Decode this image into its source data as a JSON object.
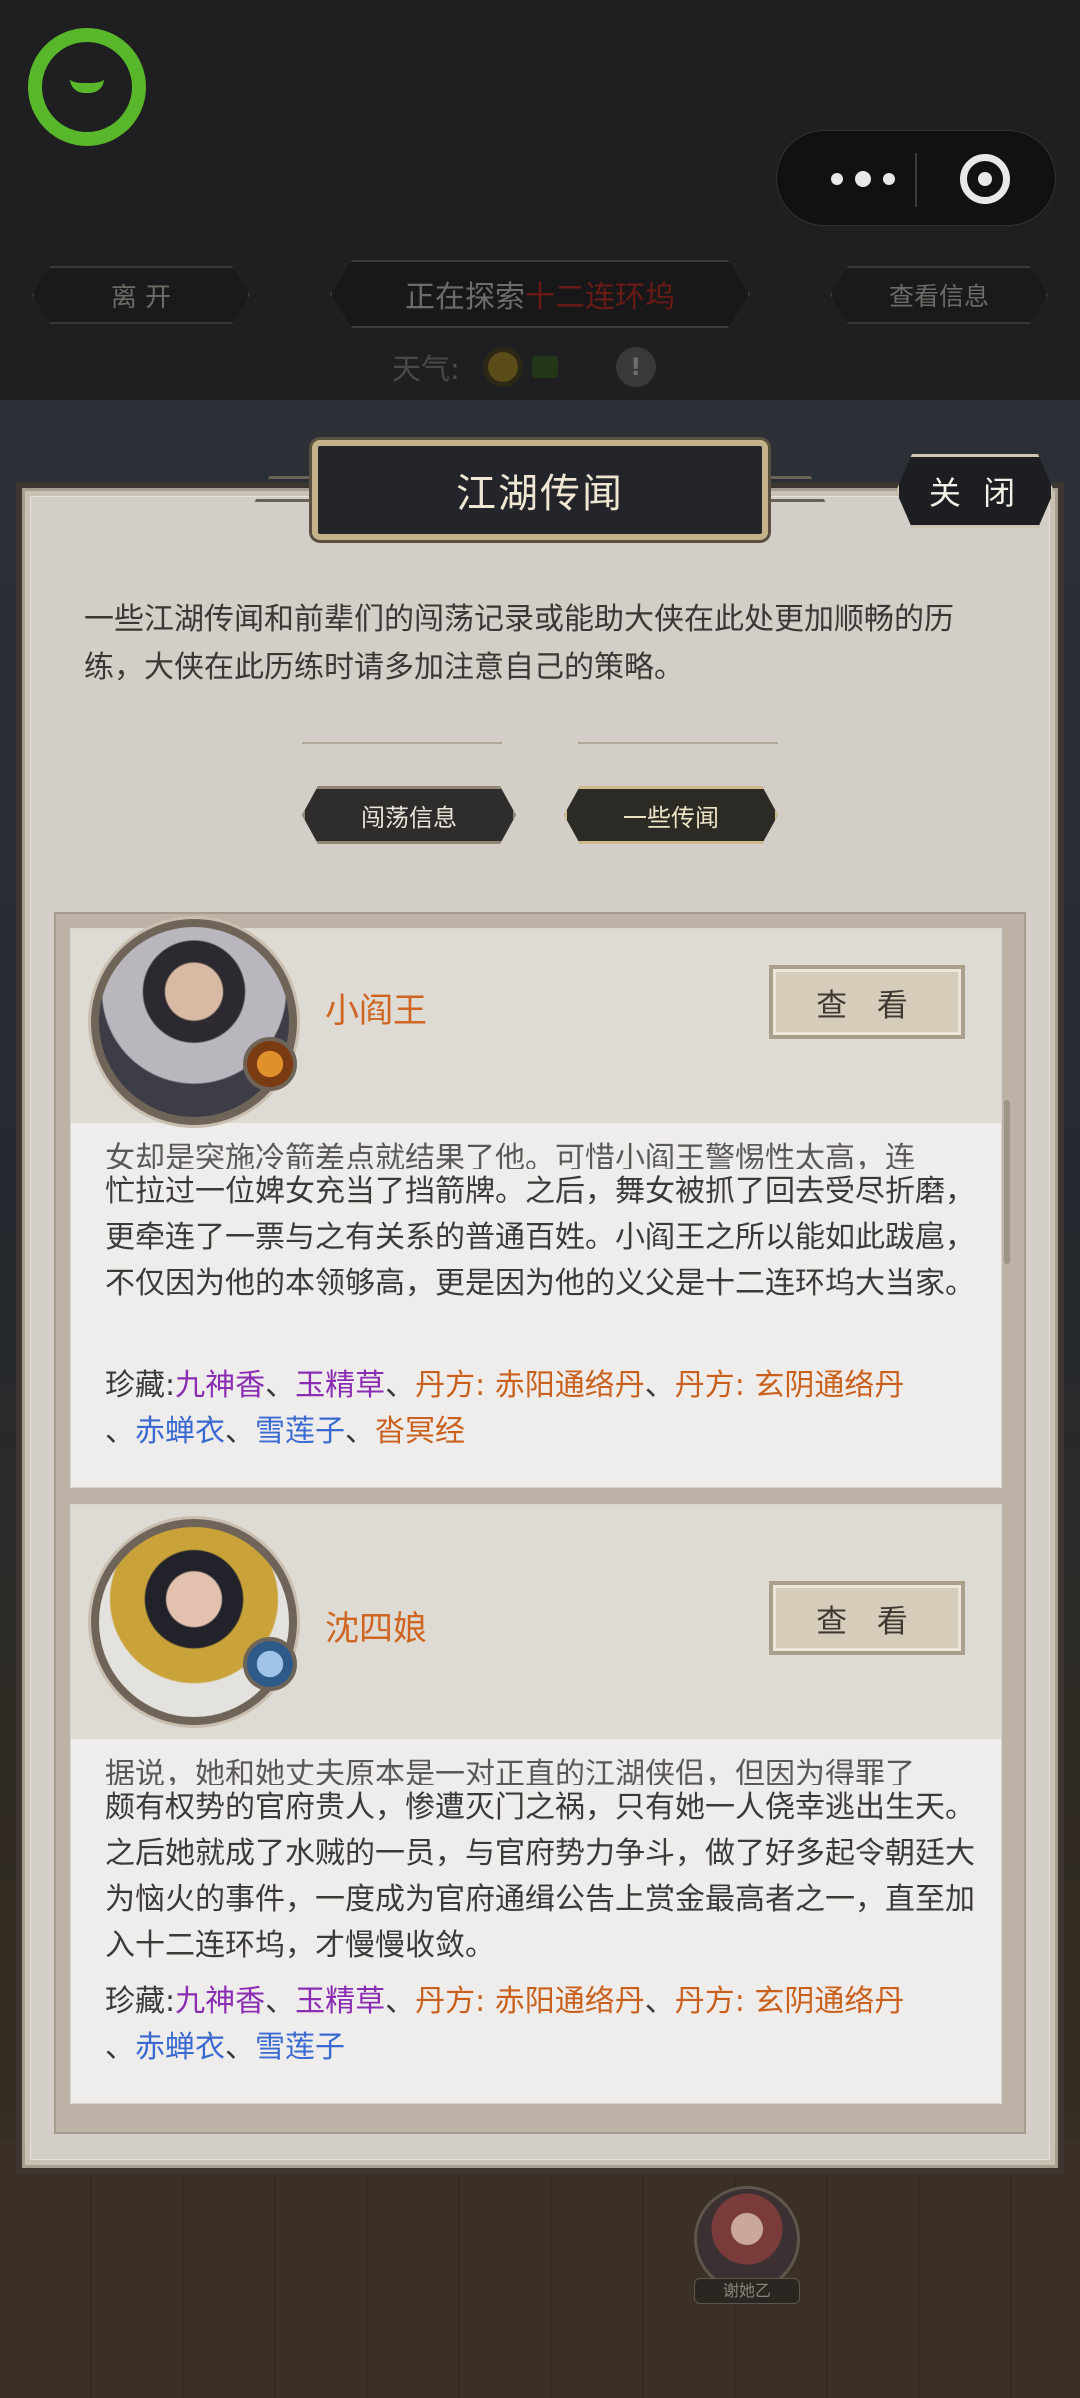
{
  "nav": {
    "leave_label": "离 开",
    "explore_prefix": "正在探索",
    "explore_location": "十二连环坞",
    "info_label": "查看信息",
    "weather_label": "天气:",
    "warning_symbol": "!"
  },
  "panel": {
    "title": "江湖传闻",
    "close_label": "关 闭",
    "intro": "一些江湖传闻和前辈们的闯荡记录或能助大侠在此处更加顺畅的历练，大侠在此历练时请多加注意自己的策略。",
    "tabs": [
      {
        "label": "闯荡信息",
        "active": false
      },
      {
        "label": "一些传闻",
        "active": true
      }
    ]
  },
  "characters": [
    {
      "name": "小阎王",
      "view_label": "查 看",
      "bio_cut": "女却是突施冷箭差点就结果了他。可惜小阎王警惕性太高，连",
      "bio": "忙拉过一位婢女充当了挡箭牌。之后，舞女被抓了回去受尽折磨，更牵连了一票与之有关系的普通百姓。小阎王之所以能如此跋扈，不仅因为他的本领够高，更是因为他的义父是十二连环坞大当家。",
      "treasure_label": "珍藏:",
      "treasures": [
        {
          "text": "九神香",
          "color": "purple"
        },
        {
          "text": "玉精草",
          "color": "purple"
        },
        {
          "text": "丹方: 赤阳通络丹",
          "color": "orange"
        },
        {
          "text": "丹方: 玄阴通络丹",
          "color": "orange"
        },
        {
          "text": "赤蝉衣",
          "color": "blue"
        },
        {
          "text": "雪莲子",
          "color": "blue"
        },
        {
          "text": "沓冥经",
          "color": "orange"
        }
      ]
    },
    {
      "name": "沈四娘",
      "view_label": "查 看",
      "bio_cut": "据说，她和她丈夫原本是一对正直的江湖侠侣，但因为得罪了",
      "bio": "颇有权势的官府贵人，惨遭灭门之祸，只有她一人侥幸逃出生天。之后她就成了水贼的一员，与官府势力争斗，做了好多起令朝廷大为恼火的事件，一度成为官府通缉公告上赏金最高者之一，直至加入十二连环坞，才慢慢收敛。",
      "treasure_label": "珍藏:",
      "treasures": [
        {
          "text": "九神香",
          "color": "purple"
        },
        {
          "text": "玉精草",
          "color": "purple"
        },
        {
          "text": "丹方: 赤阳通络丹",
          "color": "orange"
        },
        {
          "text": "丹方: 玄阴通络丹",
          "color": "orange"
        },
        {
          "text": "赤蝉衣",
          "color": "blue"
        },
        {
          "text": "雪莲子",
          "color": "blue"
        }
      ]
    }
  ],
  "scene": {
    "npc_tag": "谢她乙"
  }
}
